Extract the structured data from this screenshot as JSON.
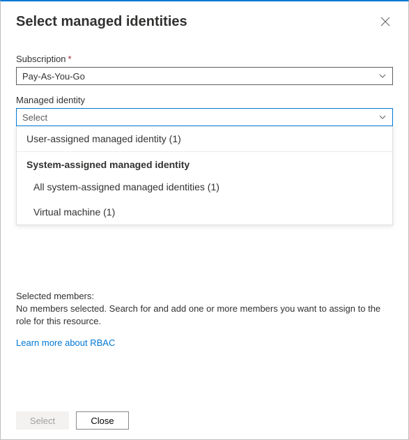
{
  "header": {
    "title": "Select managed identities"
  },
  "subscription": {
    "label": "Subscription",
    "required_marker": "*",
    "value": "Pay-As-You-Go"
  },
  "managed_identity": {
    "label": "Managed identity",
    "placeholder": "Select",
    "dropdown": {
      "user_assigned": "User-assigned managed identity (1)",
      "system_header": "System-assigned managed identity",
      "all_system": "All system-assigned managed identities (1)",
      "vm": "Virtual machine (1)"
    }
  },
  "selected": {
    "label": "Selected members:",
    "message": "No members selected. Search for and add one or more members you want to assign to the role for this resource."
  },
  "learn_link": "Learn more about RBAC",
  "footer": {
    "select": "Select",
    "close": "Close"
  }
}
